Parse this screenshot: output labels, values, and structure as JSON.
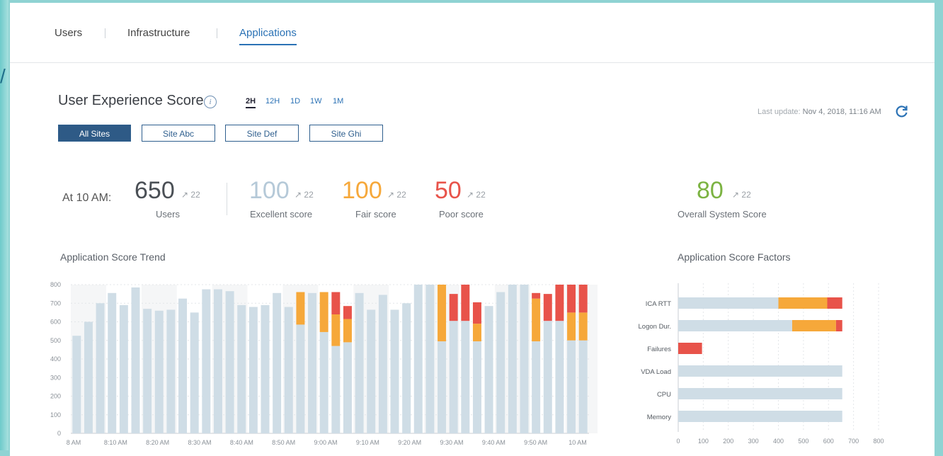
{
  "nav": {
    "tabs": [
      {
        "label": "Users"
      },
      {
        "label": "Infrastructure"
      },
      {
        "label": "Applications"
      }
    ],
    "active_tab": "Applications"
  },
  "header": {
    "title": "User Experience Score",
    "info_icon": "info-icon",
    "time_ranges": [
      "2H",
      "12H",
      "1D",
      "1W",
      "1M"
    ],
    "active_range": "2H",
    "last_update_label": "Last update:",
    "last_update_value": "Nov 4, 2018, 11:16 AM",
    "refresh_icon": "refresh-icon"
  },
  "sites": {
    "buttons": [
      "All Sites",
      "Site Abc",
      "Site Def",
      "Site Ghi"
    ],
    "active": "All Sites"
  },
  "stats": {
    "at_label": "At 10 AM:",
    "users": {
      "value": "650",
      "delta": "22",
      "label": "Users"
    },
    "excellent": {
      "value": "100",
      "delta": "22",
      "label": "Excellent score"
    },
    "fair": {
      "value": "100",
      "delta": "22",
      "label": "Fair score"
    },
    "poor": {
      "value": "50",
      "delta": "22",
      "label": "Poor score"
    },
    "overall": {
      "value": "80",
      "delta": "22",
      "label": "Overall System Score"
    },
    "delta_icon": "arrow-up-right-icon"
  },
  "colors": {
    "primary": "#2e5a86",
    "link": "#2b72b5",
    "excellent": "#cfdde6",
    "fair": "#f6a83a",
    "poor": "#e8534a",
    "overall": "#7cb342"
  },
  "chart_data": [
    {
      "type": "bar",
      "stacked": true,
      "title": "Application Score Trend",
      "ylim": [
        0,
        800
      ],
      "yticks": [
        0,
        100,
        200,
        300,
        400,
        500,
        600,
        700,
        800
      ],
      "x_tick_labels": [
        "8 AM",
        "8:10 AM",
        "8:20 AM",
        "8:30 AM",
        "8:40 AM",
        "8:50 AM",
        "9:00 AM",
        "9:10 AM",
        "9:20 AM",
        "9:30 AM",
        "9:40 AM",
        "9:50 AM",
        "10 AM"
      ],
      "grid": true,
      "series": [
        {
          "color": "#cfdde6",
          "values": [
            525,
            600,
            700,
            755,
            690,
            785,
            670,
            660,
            665,
            725,
            650,
            775,
            775,
            765,
            690,
            680,
            690,
            755,
            680,
            585,
            755,
            545,
            470,
            490,
            755,
            665,
            745,
            665,
            700,
            800,
            800,
            495,
            605,
            605,
            495,
            685,
            760,
            800,
            800,
            495,
            605,
            605,
            500,
            500
          ]
        },
        {
          "color": "#f6a83a",
          "values": [
            0,
            0,
            0,
            0,
            0,
            0,
            0,
            0,
            0,
            0,
            0,
            0,
            0,
            0,
            0,
            0,
            0,
            0,
            0,
            175,
            0,
            215,
            170,
            125,
            0,
            0,
            0,
            0,
            0,
            0,
            0,
            305,
            0,
            0,
            95,
            0,
            0,
            0,
            0,
            230,
            0,
            0,
            150,
            150
          ]
        },
        {
          "color": "#e8534a",
          "values": [
            0,
            0,
            0,
            0,
            0,
            0,
            0,
            0,
            0,
            0,
            0,
            0,
            0,
            0,
            0,
            0,
            0,
            0,
            0,
            0,
            0,
            0,
            120,
            70,
            0,
            0,
            0,
            0,
            0,
            0,
            0,
            0,
            145,
            195,
            115,
            0,
            0,
            0,
            0,
            30,
            145,
            195,
            150,
            150
          ]
        }
      ]
    },
    {
      "type": "bar",
      "orientation": "horizontal",
      "stacked": true,
      "title": "Application Score Factors",
      "categories": [
        "ICA RTT",
        "Logon Dur.",
        "Failures",
        "VDA Load",
        "CPU",
        "Memory"
      ],
      "xlim": [
        0,
        800
      ],
      "xticks": [
        0,
        100,
        200,
        300,
        400,
        500,
        600,
        700,
        800
      ],
      "grid": true,
      "series": [
        {
          "color": "#cfdde6",
          "values": [
            400,
            455,
            0,
            655,
            655,
            655
          ]
        },
        {
          "color": "#f6a83a",
          "values": [
            195,
            175,
            0,
            0,
            0,
            0
          ]
        },
        {
          "color": "#e8534a",
          "values": [
            60,
            25,
            95,
            0,
            0,
            0
          ]
        }
      ]
    }
  ]
}
